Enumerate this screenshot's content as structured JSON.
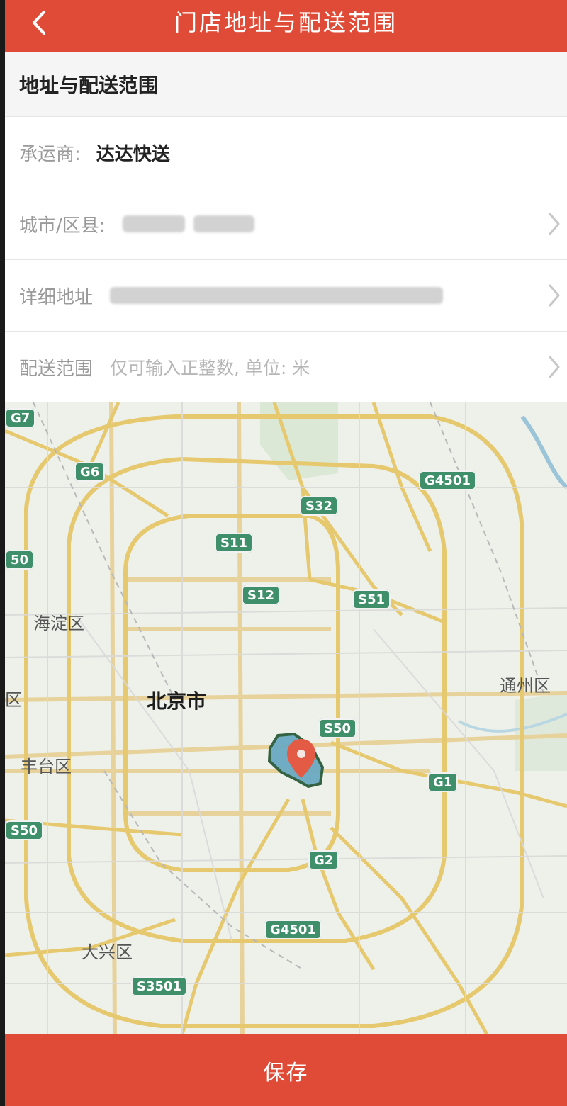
{
  "header": {
    "title": "门店地址与配送范围"
  },
  "section": {
    "title": "地址与配送范围"
  },
  "rows": {
    "carrier": {
      "label": "承运商:",
      "value": "达达快送"
    },
    "city": {
      "label": "城市/区县:"
    },
    "address": {
      "label": "详细地址"
    },
    "range": {
      "label": "配送范围",
      "placeholder": "仅可输入正整数, 单位: 米"
    }
  },
  "map": {
    "places": {
      "city": "北京市",
      "haidian": "海淀区",
      "fengtai": "丰台区",
      "daxing": "大兴区",
      "tongzhou": "通州区",
      "left_edge": "区"
    },
    "badges": {
      "g7": "G7",
      "g6": "G6",
      "g4501_top": "G4501",
      "s32": "S32",
      "s11": "S11",
      "s12": "S12",
      "s51": "S51",
      "left50": "50",
      "s50_mid": "S50",
      "g1": "G1",
      "s50_left": "S50",
      "g2": "G2",
      "g4501_bottom": "G4501",
      "s3501": "S3501"
    }
  },
  "footer": {
    "save_label": "保存"
  },
  "icons": {
    "back": "chevron-left-icon",
    "row_chevron": "chevron-right-icon",
    "pin": "map-pin-icon"
  }
}
